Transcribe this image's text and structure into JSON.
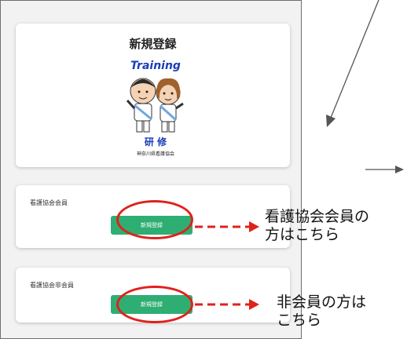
{
  "hero": {
    "title": "新規登録",
    "logo": {
      "banner_text": "Training",
      "kanji_text": "研 修",
      "org_text": "神奈川県看護協会"
    }
  },
  "member_card": {
    "label": "看護協会会員",
    "button_label": "新規登録"
  },
  "nonmember_card": {
    "label": "看護協会非会員",
    "button_label": "新規登録"
  },
  "annotations": {
    "member_note_line1": "看護協会会員の",
    "member_note_line2": "方はこちら",
    "nonmember_note_line1": "非会員の方は",
    "nonmember_note_line2": "こちら"
  },
  "colors": {
    "button_green": "#2fae73",
    "annotation_red": "#e0211b",
    "logo_blue": "#1a3db8"
  }
}
